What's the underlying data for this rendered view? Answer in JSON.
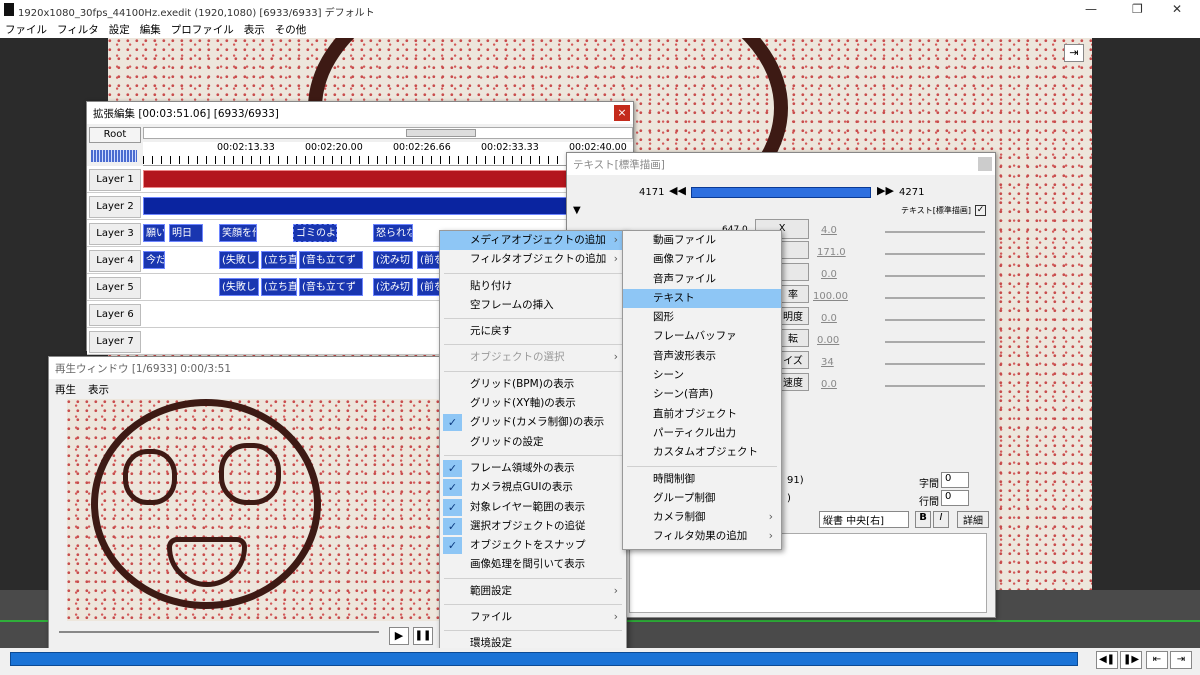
{
  "app": {
    "title": "1920x1080_30fps_44100Hz.exedit (1920,1080)  [6933/6933]  デフォルト",
    "menu": [
      "ファイル",
      "フィルタ",
      "設定",
      "編集",
      "プロファイル",
      "表示",
      "その他"
    ]
  },
  "ext_window": {
    "title": "拡張編集 [00:03:51.06] [6933/6933]",
    "root_label": "Root",
    "ticks": [
      "00:02:13.33",
      "00:02:20.00",
      "00:02:26.66",
      "00:02:33.33",
      "00:02:40.00"
    ],
    "layers": [
      "Layer 1",
      "Layer 2",
      "Layer 3",
      "Layer 4",
      "Layer 5",
      "Layer 6",
      "Layer 7"
    ],
    "layer3_clips": [
      "願い",
      "明日",
      "笑顔を作",
      "ゴミのよう",
      "怒られな"
    ],
    "layer4_clips": [
      "今だ",
      "(失敗し",
      "(立ち直",
      "(音も立てず",
      "(沈み切",
      "(前を"
    ],
    "layer5_clips": [
      "(失敗し",
      "(立ち直",
      "(音も立てず",
      "(沈み切",
      "(前を"
    ]
  },
  "text_window": {
    "title": "テキスト[標準描画]",
    "frame_start": "4171",
    "frame_end": "4271",
    "mode_label": "テキスト[標準描画]",
    "params": [
      {
        "label": "X",
        "left": "647.0",
        "right": "4.0"
      },
      {
        "label": "",
        "left": "",
        "right": "171.0"
      },
      {
        "label": "",
        "left": "",
        "right": "0.0"
      },
      {
        "label": "率",
        "left": "",
        "right": "100.00"
      },
      {
        "label": "明度",
        "left": "",
        "right": "0.0"
      },
      {
        "label": "転",
        "left": "",
        "right": "0.00"
      },
      {
        "label": "イズ",
        "left": "",
        "right": "34"
      },
      {
        "label": "速度",
        "left": "",
        "right": "0.0"
      }
    ],
    "line_a": "91)",
    "line_b": ")",
    "kanji_label": "字間",
    "kanji_val": "0",
    "gyou_label": "行間",
    "gyou_val": "0",
    "align_value": "縦書 中央[右]",
    "bold": "B",
    "italic": "I",
    "detail": "詳細"
  },
  "play_window": {
    "title": "再生ウィンドウ [1/6933]  0:00/3:51",
    "menu": [
      "再生",
      "表示"
    ]
  },
  "context_menu": [
    {
      "label": "メディアオブジェクトの追加",
      "arrow": true,
      "hl": true
    },
    {
      "label": "フィルタオブジェクトの追加",
      "arrow": true
    },
    {
      "sep": true
    },
    {
      "label": "貼り付け"
    },
    {
      "label": "空フレームの挿入"
    },
    {
      "sep": true
    },
    {
      "label": "元に戻す"
    },
    {
      "sep": true
    },
    {
      "label": "オブジェクトの選択",
      "arrow": true,
      "dis": true
    },
    {
      "sep": true
    },
    {
      "label": "グリッド(BPM)の表示"
    },
    {
      "label": "グリッド(XY軸)の表示"
    },
    {
      "label": "グリッド(カメラ制御)の表示",
      "check": true
    },
    {
      "label": "グリッドの設定"
    },
    {
      "sep": true
    },
    {
      "label": "フレーム領域外の表示",
      "check": true
    },
    {
      "label": "カメラ視点GUIの表示",
      "check": true
    },
    {
      "label": "対象レイヤー範囲の表示",
      "check": true
    },
    {
      "label": "選択オブジェクトの追従",
      "check": true
    },
    {
      "label": "オブジェクトをスナップ",
      "check": true
    },
    {
      "label": "画像処理を間引いて表示"
    },
    {
      "sep": true
    },
    {
      "label": "範囲設定",
      "arrow": true
    },
    {
      "sep": true
    },
    {
      "label": "ファイル",
      "arrow": true
    },
    {
      "sep": true
    },
    {
      "label": "環境設定"
    }
  ],
  "submenu": [
    {
      "label": "動画ファイル"
    },
    {
      "label": "画像ファイル"
    },
    {
      "label": "音声ファイル"
    },
    {
      "label": "テキスト",
      "hl": true
    },
    {
      "label": "図形"
    },
    {
      "label": "フレームバッファ"
    },
    {
      "label": "音声波形表示"
    },
    {
      "label": "シーン"
    },
    {
      "label": "シーン(音声)"
    },
    {
      "label": "直前オブジェクト"
    },
    {
      "label": "パーティクル出力"
    },
    {
      "label": "カスタムオブジェクト"
    },
    {
      "sep": true
    },
    {
      "label": "時間制御"
    },
    {
      "label": "グループ制御"
    },
    {
      "label": "カメラ制御",
      "arrow": true
    },
    {
      "label": "フィルタ効果の追加",
      "arrow": true
    }
  ],
  "colors": {
    "layer1": "#b3161d",
    "layer2": "#0a24a0",
    "clip": "#1936b0",
    "highlight": "#8ec6f5",
    "seek": "#1a73d6"
  },
  "icons": {
    "close": "close-icon",
    "play": "play-icon",
    "pause": "pause-icon",
    "pin": "pin-icon"
  }
}
